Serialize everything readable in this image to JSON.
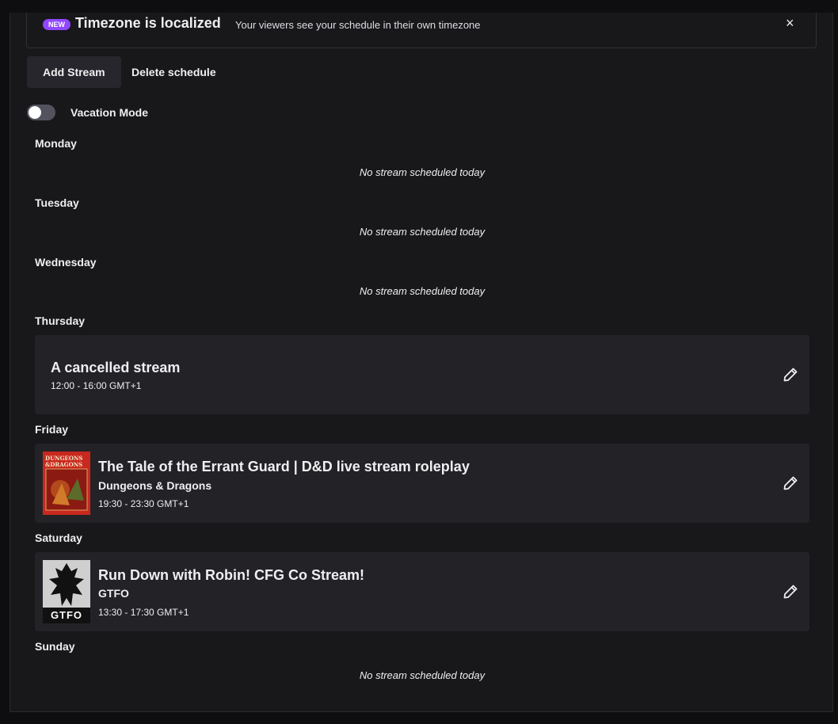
{
  "banner": {
    "badge": "NEW",
    "title": "Timezone is localized",
    "subtitle": "Your viewers see your schedule in their own timezone",
    "close_icon": "×"
  },
  "actions": {
    "add_stream": "Add Stream",
    "delete_schedule": "Delete schedule"
  },
  "vacation": {
    "label": "Vacation Mode",
    "enabled": false
  },
  "empty_text": "No stream scheduled today",
  "days": {
    "monday": "Monday",
    "tuesday": "Tuesday",
    "wednesday": "Wednesday",
    "thursday": "Thursday",
    "friday": "Friday",
    "saturday": "Saturday",
    "sunday": "Sunday"
  },
  "streams": {
    "thursday": {
      "title": "A cancelled stream",
      "time": "12:00 - 16:00 GMT+1"
    },
    "friday": {
      "title": "The Tale of the Errant Guard | D&D live stream roleplay",
      "game": "Dungeons & Dragons",
      "time": "19:30 - 23:30 GMT+1",
      "thumb_text_1": "DUNGEONS",
      "thumb_text_2": "&DRAGONS"
    },
    "saturday": {
      "title": "Run Down with Robin! CFG Co Stream!",
      "game": "GTFO",
      "time": "13:30 - 17:30 GMT+1",
      "thumb_text": "GTFO"
    }
  },
  "colors": {
    "accent": "#9147ff",
    "background": "#0e0e10",
    "panel": "#18181b",
    "card": "#232327"
  }
}
